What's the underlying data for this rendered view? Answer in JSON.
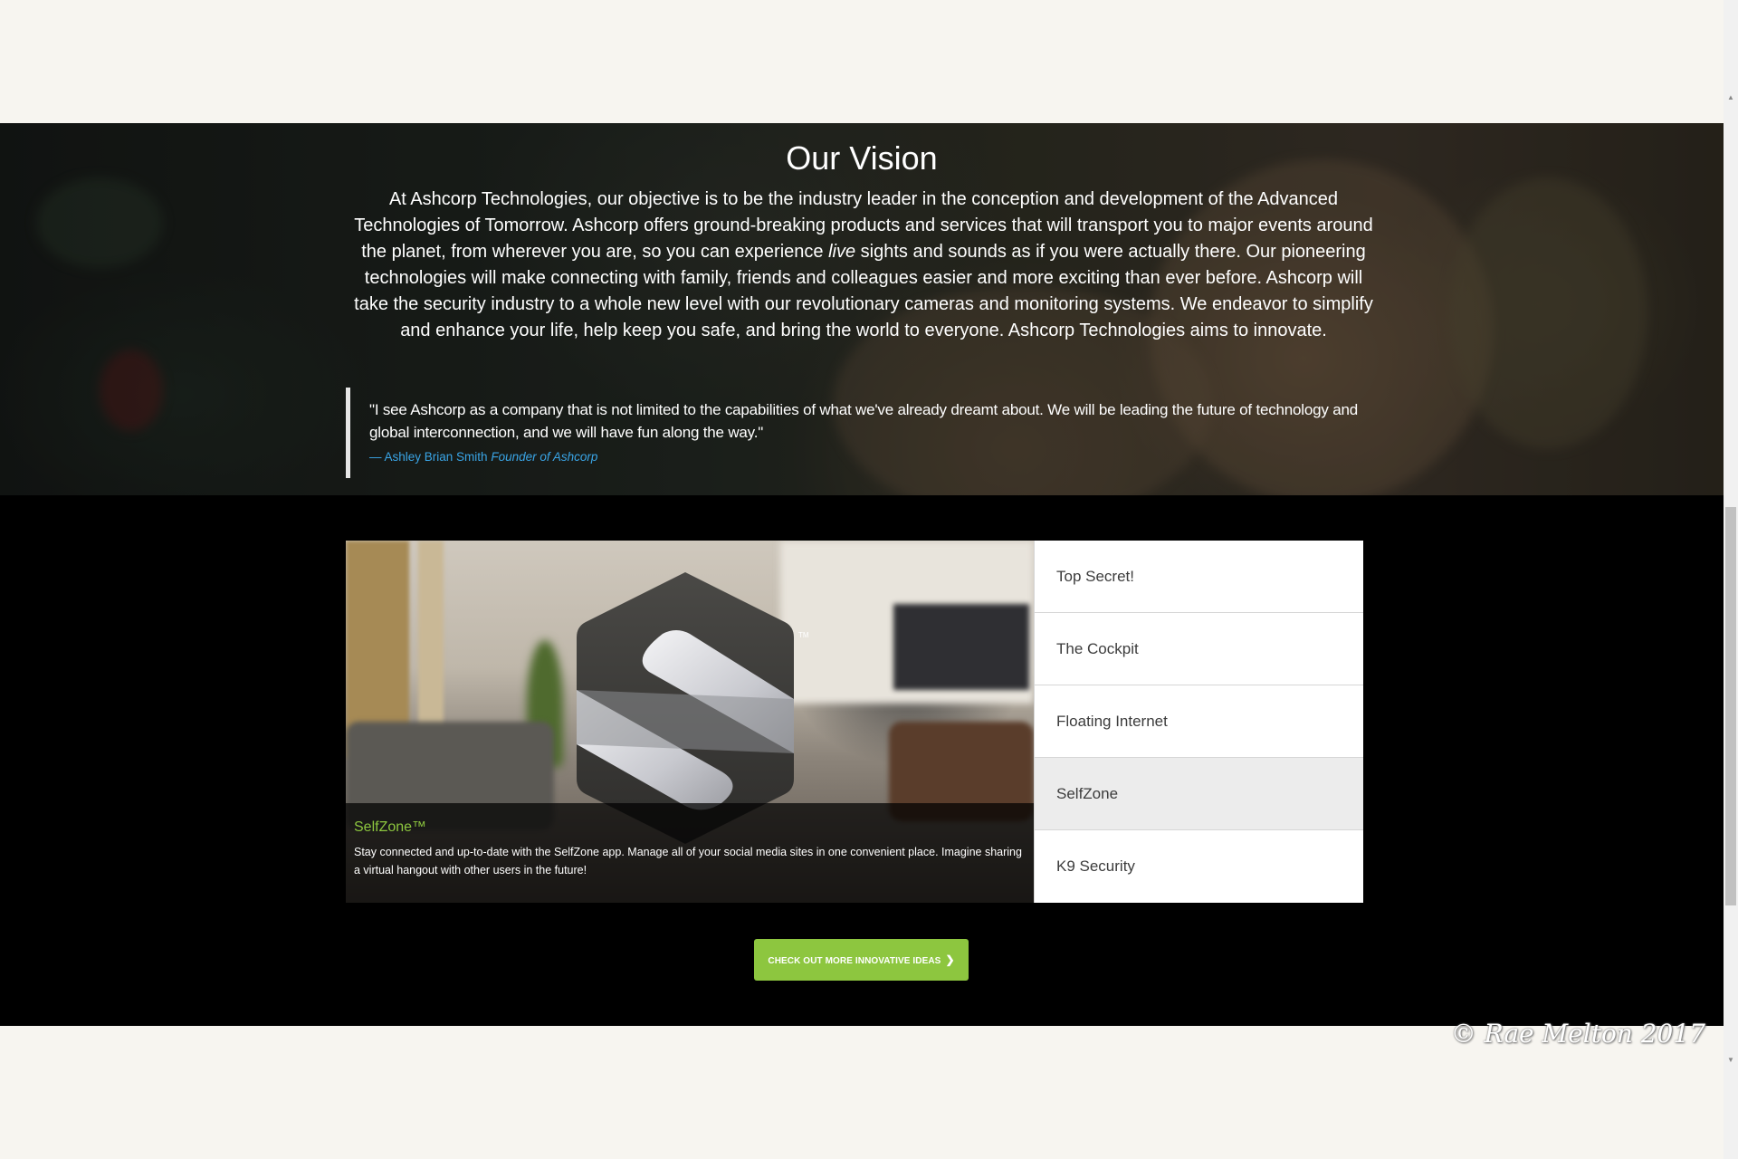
{
  "vision": {
    "title": "Our Vision",
    "body_before": "At Ashcorp Technologies, our objective is to be the industry leader in the conception and development of the Advanced Technologies of Tomorrow. Ashcorp offers ground-breaking products and services that will transport you to major events around the planet, from wherever you are, so you can experience ",
    "body_em": "live",
    "body_after": " sights and sounds as if you were actually there. Our pioneering technologies will make connecting with family, friends and colleagues easier and more exciting than ever before. Ashcorp will take the security industry to a whole new level with our revolutionary cameras and monitoring systems. We endeavor to simplify and enhance your life, help keep you safe, and bring the world to everyone. Ashcorp Technologies aims to innovate.",
    "quote": "\"I see Ashcorp as a company that is not limited to the capabilities of what we've already dreamt about. We will be leading the future of technology and global interconnection, and we will have fun along the way.\"",
    "cite_name": "— Ashley Brian Smith",
    "cite_title": "Founder of Ashcorp"
  },
  "feature": {
    "tm": "TM",
    "title": "SelfZone™",
    "text": "Stay connected and up-to-date with the SelfZone app. Manage all of your social media sites in one convenient place. Imagine sharing a virtual hangout with other users in the future!"
  },
  "tabs": [
    {
      "label": "Top Secret!",
      "active": false
    },
    {
      "label": "The Cockpit",
      "active": false
    },
    {
      "label": "Floating Internet",
      "active": false
    },
    {
      "label": "SelfZone",
      "active": true
    },
    {
      "label": "K9 Security",
      "active": false
    }
  ],
  "cta": {
    "label": "CHECK OUT MORE INNOVATIVE IDEAS",
    "icon": "chevron-right-icon"
  },
  "signature": "© Rae Melton 2017",
  "colors": {
    "accent": "#8dc63f",
    "link": "#3aa5e6",
    "section_bg": "#000000",
    "page_bg": "#f7f5f0"
  }
}
